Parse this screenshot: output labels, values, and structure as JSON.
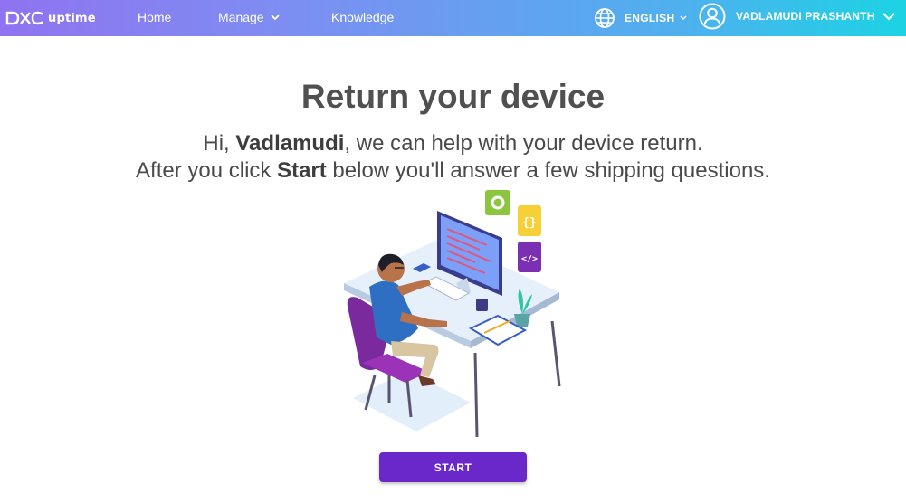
{
  "header": {
    "brand_text": "uptime",
    "brand_logo": "dxc-logo",
    "nav": {
      "home": "Home",
      "manage": "Manage",
      "knowledge": "Knowledge"
    },
    "language": {
      "label": "ENGLISH",
      "icon": "globe-icon"
    },
    "user": {
      "name": "VADLAMUDI PRASHANTH",
      "icon": "user-circle-icon"
    },
    "gradient": [
      "#8f73f0",
      "#1cd3e4"
    ]
  },
  "main": {
    "title": "Return your device",
    "line1": {
      "prefix": "Hi, ",
      "name": "Vadlamudi",
      "suffix": ", we can help with your device return."
    },
    "line2": {
      "prefix": "After you click ",
      "bold": "Start",
      "suffix": " below you'll answer a few shipping questions."
    },
    "illustration": "person-working-at-desk-illustration",
    "start_button": "START",
    "button_color": "#6a27c9"
  }
}
